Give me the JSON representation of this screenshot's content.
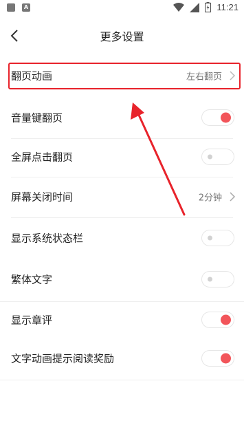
{
  "status_bar": {
    "time": "11:21",
    "left_icons": [
      "image-icon",
      "a-box-icon"
    ],
    "right_icons": [
      "wifi-icon",
      "signal-icon",
      "battery-icon"
    ]
  },
  "header": {
    "title": "更多设置",
    "back_icon": "chevron-left-icon"
  },
  "settings": [
    {
      "label": "翻页动画",
      "value": "左右翻页",
      "type": "link",
      "highlighted": true
    },
    {
      "label": "音量键翻页",
      "type": "toggle",
      "on": true
    },
    {
      "label": "全屏点击翻页",
      "type": "toggle",
      "on": false
    },
    {
      "label": "屏幕关闭时间",
      "value": "2分钟",
      "type": "link"
    },
    {
      "label": "显示系统状态栏",
      "type": "toggle",
      "on": false
    },
    {
      "label": "繁体文字",
      "type": "toggle",
      "on": false
    },
    {
      "label": "显示章评",
      "type": "toggle",
      "on": true
    },
    {
      "label": "文字动画提示阅读奖励",
      "type": "toggle",
      "on": true
    }
  ],
  "colors": {
    "toggle_on": "#f2555a",
    "toggle_off_knob": "#d2d2d2",
    "annotation_red": "#e8232b"
  }
}
